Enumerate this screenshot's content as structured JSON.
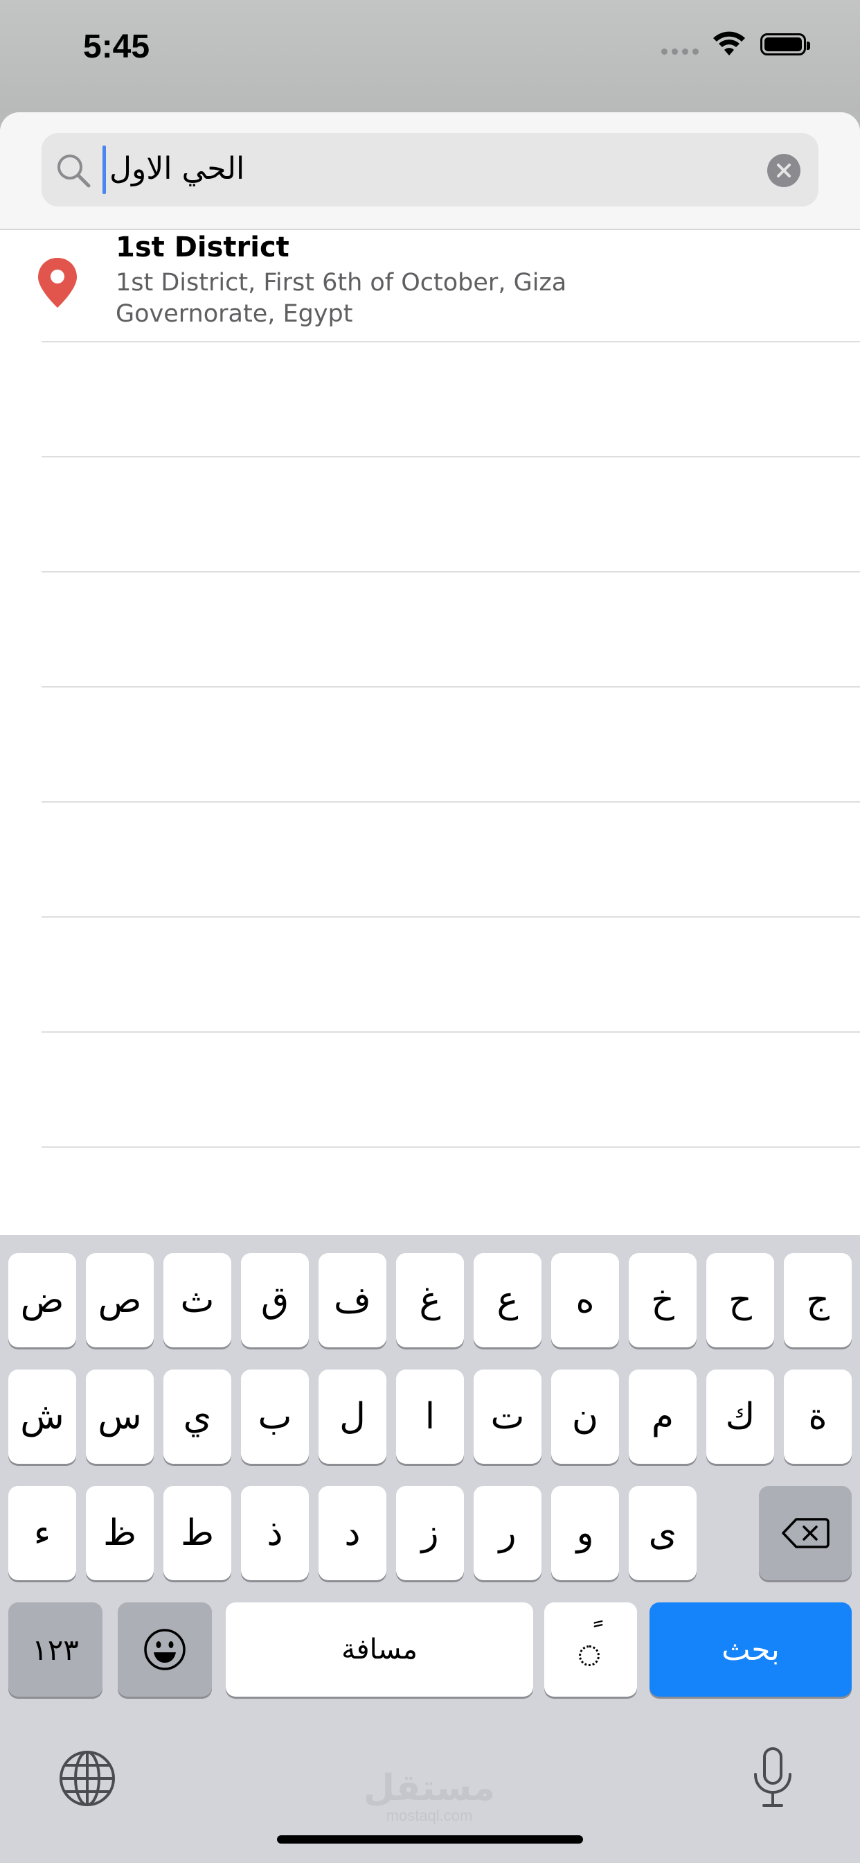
{
  "status_bar": {
    "time": "5:45",
    "wifi_icon": "wifi-icon",
    "battery_icon": "battery-icon"
  },
  "search": {
    "value": "الحي الاول",
    "search_icon": "magnifier-icon",
    "clear_icon": "clear-x-icon"
  },
  "results": [
    {
      "title": "1st District",
      "subtitle": "1st District, First 6th of October, Giza Governorate, Egypt",
      "icon": "map-pin-icon",
      "pin_color": "#e2554c"
    }
  ],
  "keyboard": {
    "row1": [
      "ض",
      "ص",
      "ث",
      "ق",
      "ف",
      "غ",
      "ع",
      "ه",
      "خ",
      "ح",
      "ج"
    ],
    "row2": [
      "ش",
      "س",
      "ي",
      "ب",
      "ل",
      "ا",
      "ت",
      "ن",
      "م",
      "ك",
      "ة"
    ],
    "row3": [
      "ء",
      "ظ",
      "ط",
      "ذ",
      "د",
      "ز",
      "ر",
      "و",
      "ى"
    ],
    "numbers_key": "١٢٣",
    "emoji_icon": "emoji-icon",
    "space_label": "مسافة",
    "tanween_key": "ً",
    "search_key": "بحث",
    "delete_icon": "delete-backspace-icon",
    "globe_icon": "globe-icon",
    "mic_icon": "microphone-icon",
    "accent_color": "#1583fa"
  },
  "watermark": {
    "arabic": "مستقل",
    "latin": "mostaql.com"
  }
}
